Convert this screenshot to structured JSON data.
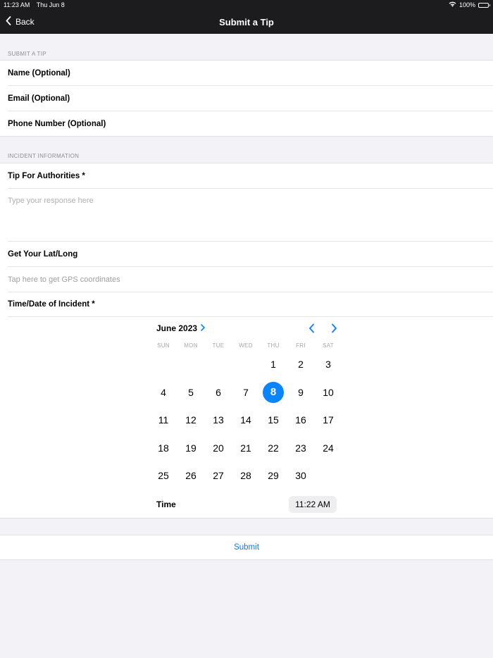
{
  "status_bar": {
    "time": "11:23 AM",
    "date": "Thu Jun 8",
    "battery": "100%"
  },
  "nav": {
    "back_label": "Back",
    "title": "Submit a Tip"
  },
  "sections": {
    "tip_header": "SUBMIT A TIP",
    "incident_header": "INCIDENT INFORMATION"
  },
  "contact": {
    "name_label": "Name (Optional)",
    "email_label": "Email (Optional)",
    "phone_label": "Phone Number (Optional)"
  },
  "incident": {
    "tip_label": "Tip For Authorities *",
    "tip_placeholder": "Type your response here",
    "latlong_label": "Get Your Lat/Long",
    "latlong_action": "Tap here to get GPS coordinates",
    "datetime_label": "Time/Date of Incident *"
  },
  "calendar": {
    "month_label": "June 2023",
    "weekdays": [
      "SUN",
      "MON",
      "TUE",
      "WED",
      "THU",
      "FRI",
      "SAT"
    ],
    "first_weekday_index": 4,
    "days_in_month": 30,
    "selected_day": 8,
    "accent_color": "#0a84ff"
  },
  "time": {
    "label": "Time",
    "value": "11:22 AM"
  },
  "submit_label": "Submit",
  "icons": {
    "back": "chevron-left-icon",
    "month_expand": "chevron-right-icon",
    "prev_month": "chevron-left-icon",
    "next_month": "chevron-right-icon",
    "wifi": "wifi-icon",
    "battery": "battery-icon"
  }
}
